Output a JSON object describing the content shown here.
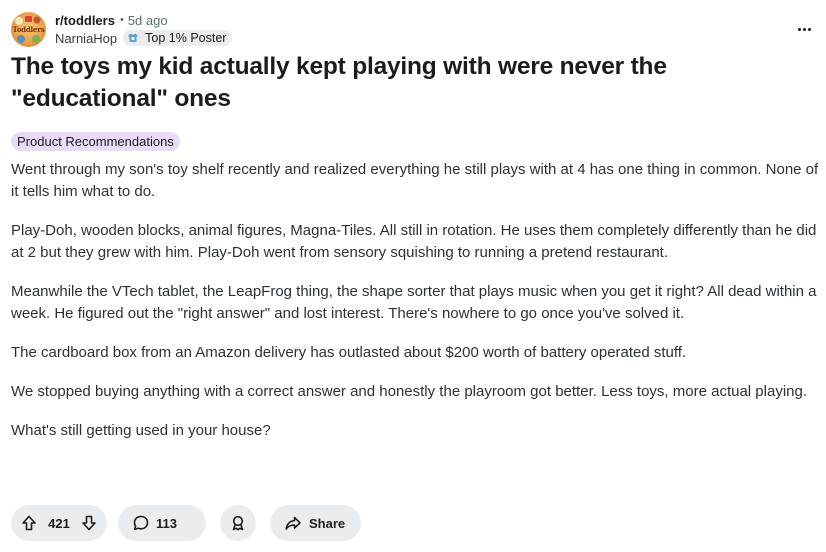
{
  "post": {
    "subreddit": "r/toddlers",
    "age": "5d ago",
    "author": "NarniaHop",
    "author_flair": "Top 1% Poster",
    "subreddit_icon_text": "Toddlers",
    "title": "The toys my kid actually kept playing with were never the \"educational\" ones",
    "flair": "Product Recommendations",
    "body": [
      "Went through my son's toy shelf recently and realized everything he still plays with at 4 has one thing in common. None of it tells him what to do.",
      "Play-Doh, wooden blocks, animal figures, Magna-Tiles. All still in rotation. He uses them completely differently than he did at 2 but they grew with him. Play-Doh went from sensory squishing to running a pretend restaurant.",
      "Meanwhile the VTech tablet, the LeapFrog thing, the shape sorter that plays music when you get it right? All dead within a week. He figured out the \"right answer\" and lost interest. There's nowhere to go once you've solved it.",
      "The cardboard box from an Amazon delivery has outlasted about $200 worth of battery operated stuff.",
      "We stopped buying anything with a correct answer and honestly the playroom got better. Less toys, more actual playing.",
      "What's still getting used in your house?"
    ]
  },
  "actions": {
    "upvotes": "421",
    "comments": "113",
    "share_label": "Share"
  },
  "icons": {
    "more": "more-horizontal-icon",
    "upvote": "arrow-up-icon",
    "downvote": "arrow-down-icon",
    "comment": "speech-bubble-icon",
    "award": "award-icon",
    "share": "share-arrow-icon",
    "flair": "top-poster-icon"
  },
  "colors": {
    "pill_bg": "#eaedef",
    "flair_bg": "#e9dcf7",
    "muted_text": "#576f76"
  }
}
